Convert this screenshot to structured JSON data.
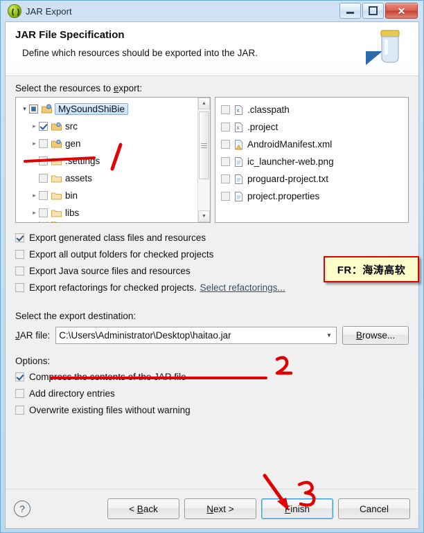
{
  "window": {
    "title": "JAR Export",
    "icon": "jar-export-icon",
    "controls": {
      "minimize": "Minimize",
      "maximize": "Maximize",
      "close": "Close"
    }
  },
  "banner": {
    "heading": "JAR File Specification",
    "description": "Define which resources should be exported into the JAR.",
    "icon": "jar-jar-icon"
  },
  "resources": {
    "label": "Select the resources to export:",
    "tree": [
      {
        "name": "MySoundShiBie",
        "icon": "java-project-icon",
        "check": "filled",
        "expander": "open",
        "indent": 0,
        "selected": true
      },
      {
        "name": "src",
        "icon": "source-folder-icon",
        "check": "checked",
        "expander": "closed",
        "indent": 1,
        "selected": false
      },
      {
        "name": "gen",
        "icon": "source-folder-icon",
        "check": "unchecked",
        "expander": "closed",
        "indent": 1,
        "selected": false
      },
      {
        "name": ".settings",
        "icon": "folder-icon",
        "check": "unchecked",
        "expander": "closed",
        "indent": 1,
        "selected": false
      },
      {
        "name": "assets",
        "icon": "folder-icon",
        "check": "unchecked",
        "expander": "none",
        "indent": 1,
        "selected": false
      },
      {
        "name": "bin",
        "icon": "folder-icon",
        "check": "unchecked",
        "expander": "closed",
        "indent": 1,
        "selected": false
      },
      {
        "name": "libs",
        "icon": "folder-icon",
        "check": "unchecked",
        "expander": "closed",
        "indent": 1,
        "selected": false
      }
    ],
    "files": [
      {
        "name": ".classpath",
        "icon": "xml-file-icon",
        "checked": false
      },
      {
        "name": ".project",
        "icon": "xml-file-icon",
        "checked": false
      },
      {
        "name": "AndroidManifest.xml",
        "icon": "android-manifest-icon",
        "checked": false
      },
      {
        "name": "ic_launcher-web.png",
        "icon": "file-icon",
        "checked": false
      },
      {
        "name": "proguard-project.txt",
        "icon": "file-icon",
        "checked": false
      },
      {
        "name": "project.properties",
        "icon": "file-icon",
        "checked": false
      }
    ]
  },
  "export_options": [
    {
      "label": "Export generated class files and resources",
      "checked": true,
      "mnemonic": "c"
    },
    {
      "label": "Export all output folders for checked projects",
      "checked": false,
      "mnemonic": "u"
    },
    {
      "label": "Export Java source files and resources",
      "checked": false,
      "mnemonic": "s"
    },
    {
      "label": "Export refactorings for checked projects.",
      "checked": false,
      "mnemonic": "x",
      "link": "Select refactorings..."
    }
  ],
  "destination": {
    "label": "Select the export destination:",
    "jar_file_label": "JAR file:",
    "jar_file_value": "C:\\Users\\Administrator\\Desktop\\haitao.jar",
    "jar_file_placeholder": "",
    "browse_label": "Browse..."
  },
  "options": {
    "title": "Options:",
    "items": [
      {
        "label": "Compress the contents of the JAR file",
        "checked": true,
        "mnemonic": "m"
      },
      {
        "label": "Add directory entries",
        "checked": false,
        "mnemonic": "d"
      },
      {
        "label": "Overwrite existing files without warning",
        "checked": false,
        "mnemonic": "O"
      }
    ]
  },
  "footer": {
    "help": "?",
    "back": "< Back",
    "next": "Next >",
    "finish": "Finish",
    "cancel": "Cancel"
  },
  "annotations": {
    "note_text": "FR：海涛高软",
    "marker_1": "1",
    "marker_2": "2",
    "marker_3": "3",
    "color": "#e00000",
    "note_bg": "#ffffcc"
  }
}
